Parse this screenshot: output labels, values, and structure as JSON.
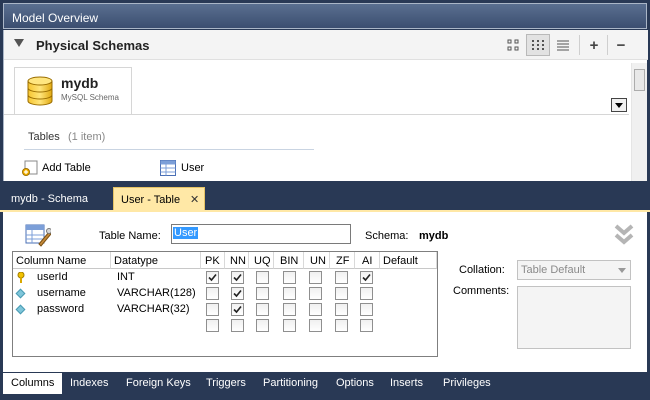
{
  "model_overview": {
    "header_title": "Model Overview",
    "section_title": "Physical Schemas",
    "toolbar": {
      "add_label": "+",
      "remove_label": "−"
    },
    "schema": {
      "name": "mydb",
      "subtitle": "MySQL Schema"
    },
    "tables": {
      "label": "Tables",
      "count": "(1 item)",
      "add_label": "Add Table",
      "items": [
        "User"
      ]
    }
  },
  "editor_tabs": [
    {
      "label": "mydb - Schema",
      "active": false
    },
    {
      "label": "User - Table",
      "active": true,
      "close": "✕"
    }
  ],
  "table_editor": {
    "table_name_label": "Table Name:",
    "table_name_value": "User",
    "schema_label": "Schema:",
    "schema_value": "mydb",
    "columns_header": [
      "Column Name",
      "Datatype",
      "PK",
      "NN",
      "UQ",
      "BIN",
      "UN",
      "ZF",
      "AI",
      "Default"
    ],
    "rows": [
      {
        "name": "userId",
        "type": "INT",
        "icon": "key-icon",
        "PK": true,
        "NN": true,
        "UQ": false,
        "BIN": false,
        "UN": false,
        "ZF": false,
        "AI": true
      },
      {
        "name": "username",
        "type": "VARCHAR(128)",
        "icon": "column-diamond-icon",
        "PK": false,
        "NN": true,
        "UQ": false,
        "BIN": false,
        "UN": false,
        "ZF": false,
        "AI": false
      },
      {
        "name": "password",
        "type": "VARCHAR(32)",
        "icon": "column-diamond-icon",
        "PK": false,
        "NN": true,
        "UQ": false,
        "BIN": false,
        "UN": false,
        "ZF": false,
        "AI": false
      },
      {
        "name": "",
        "type": "",
        "icon": "",
        "PK": false,
        "NN": false,
        "UQ": false,
        "BIN": false,
        "UN": false,
        "ZF": false,
        "AI": false
      }
    ],
    "collation_label": "Collation:",
    "collation_value": "Table Default",
    "comments_label": "Comments:"
  },
  "bottom_tabs": [
    "Columns",
    "Indexes",
    "Foreign Keys",
    "Triggers",
    "Partitioning",
    "Options",
    "Inserts",
    "Privileges"
  ],
  "active_bottom_tab": "Columns",
  "colors": {
    "frame": "#293955",
    "active_tab": "#ffe8a6",
    "selection": "#3399ff"
  }
}
